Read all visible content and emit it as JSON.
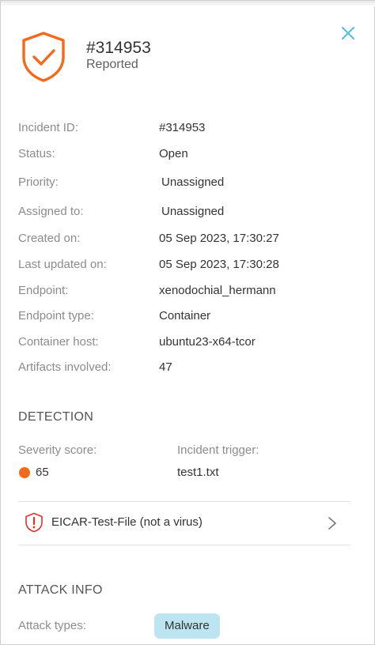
{
  "header": {
    "title": "#314953",
    "subtitle": "Reported",
    "icon": "shield-check-icon",
    "accent_color": "#f26a1b"
  },
  "details": [
    {
      "label": "Incident ID:",
      "value": "#314953"
    },
    {
      "label": "Status:",
      "value": "Open"
    },
    {
      "label": "Priority:",
      "value": "Unassigned"
    },
    {
      "label": "Assigned to:",
      "value": "Unassigned"
    },
    {
      "label": "Created on:",
      "value": "05 Sep 2023, 17:30:27"
    },
    {
      "label": "Last updated on:",
      "value": "05 Sep 2023, 17:30:28"
    },
    {
      "label": "Endpoint:",
      "value": "xenodochial_hermann"
    },
    {
      "label": "Endpoint type:",
      "value": "Container"
    },
    {
      "label": "Container host:",
      "value": "ubuntu23-x64-tcor"
    },
    {
      "label": "Artifacts involved:",
      "value": "47"
    }
  ],
  "detection": {
    "heading": "DETECTION",
    "severity_label": "Severity score:",
    "severity_value": "65",
    "severity_color": "#f26a1b",
    "trigger_label": "Incident trigger:",
    "trigger_value": "test1.txt",
    "threat_name": "EICAR-Test-File (not a virus)",
    "threat_icon": "shield-alert-icon",
    "threat_color": "#e0302c"
  },
  "attack_info": {
    "heading": "ATTACK INFO",
    "types_label": "Attack types:",
    "types": [
      "Malware"
    ],
    "badge_color": "#bde4f1"
  }
}
